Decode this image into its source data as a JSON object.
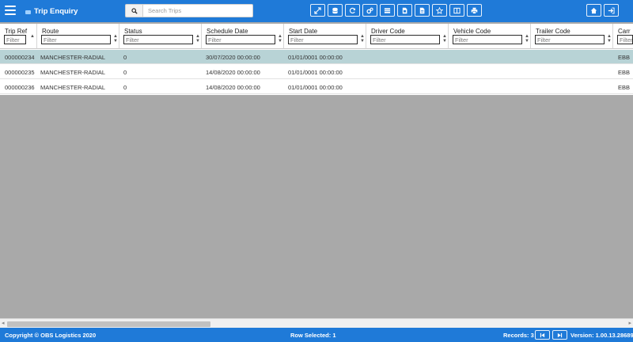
{
  "header": {
    "title": "Trip Enquiry",
    "menu_icon": "hamburger-icon",
    "search_placeholder": "Search Trips",
    "tools": [
      {
        "name": "expand-icon"
      },
      {
        "name": "database-icon"
      },
      {
        "name": "refresh-icon"
      },
      {
        "name": "cogs-icon"
      },
      {
        "name": "list-icon"
      },
      {
        "name": "export-icon"
      },
      {
        "name": "document-icon"
      },
      {
        "name": "star-icon"
      },
      {
        "name": "columns-icon"
      },
      {
        "name": "print-icon"
      }
    ],
    "right_tools": [
      {
        "name": "home-icon"
      },
      {
        "name": "sign-out-icon"
      }
    ]
  },
  "grid": {
    "filter_placeholder": "Filter",
    "columns": [
      "Trip Ref",
      "Route",
      "Status",
      "Schedule Date",
      "Start Date",
      "Driver Code",
      "Vehicle Code",
      "Trailer Code",
      "Carr"
    ],
    "rows": [
      {
        "trip_ref": "000000234",
        "route": "MANCHESTER-RADIAL",
        "status": "0",
        "schedule_date": "30/07/2020 00:00:00",
        "start_date": "01/01/0001 00:00:00",
        "driver_code": "",
        "vehicle_code": "",
        "trailer_code": "",
        "carrier": "EBB",
        "selected": true
      },
      {
        "trip_ref": "000000235",
        "route": "MANCHESTER-RADIAL",
        "status": "0",
        "schedule_date": "14/08/2020 00:00:00",
        "start_date": "01/01/0001 00:00:00",
        "driver_code": "",
        "vehicle_code": "",
        "trailer_code": "",
        "carrier": "EBB",
        "selected": false
      },
      {
        "trip_ref": "000000236",
        "route": "MANCHESTER-RADIAL",
        "status": "0",
        "schedule_date": "14/08/2020 00:00:00",
        "start_date": "01/01/0001 00:00:00",
        "driver_code": "",
        "vehicle_code": "",
        "trailer_code": "",
        "carrier": "EBB",
        "selected": false
      }
    ]
  },
  "footer": {
    "copyright": "Copyright © OBS Logistics 2020",
    "row_selected": "Row Selected: 1",
    "records": "Records: 3",
    "version": "Version: 1.00.13.28689"
  },
  "colors": {
    "brand": "#1f7ad8",
    "selected_row": "#b8d3d6",
    "background": "#a9a9a9"
  }
}
